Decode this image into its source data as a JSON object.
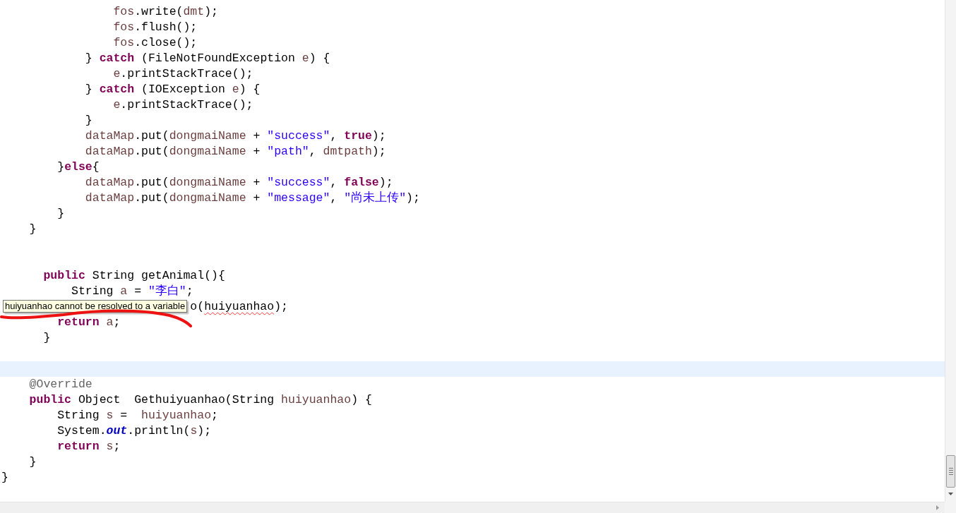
{
  "editor": {
    "lines": [
      {
        "current": false,
        "tokens": [
          {
            "text": "                fos",
            "kind": "local"
          },
          {
            "text": ".write(",
            "kind": "plain"
          },
          {
            "text": "dmt",
            "kind": "local"
          },
          {
            "text": ");",
            "kind": "plain"
          }
        ]
      },
      {
        "current": false,
        "tokens": [
          {
            "text": "                fos",
            "kind": "local"
          },
          {
            "text": ".flush();",
            "kind": "plain"
          }
        ]
      },
      {
        "current": false,
        "tokens": [
          {
            "text": "                fos",
            "kind": "local"
          },
          {
            "text": ".close();",
            "kind": "plain"
          }
        ]
      },
      {
        "current": false,
        "tokens": [
          {
            "text": "            } ",
            "kind": "plain"
          },
          {
            "text": "catch",
            "kind": "keyword"
          },
          {
            "text": " (FileNotFoundException ",
            "kind": "plain"
          },
          {
            "text": "e",
            "kind": "local"
          },
          {
            "text": ") {",
            "kind": "plain"
          }
        ]
      },
      {
        "current": false,
        "tokens": [
          {
            "text": "                e",
            "kind": "local"
          },
          {
            "text": ".printStackTrace();",
            "kind": "plain"
          }
        ]
      },
      {
        "current": false,
        "tokens": [
          {
            "text": "            } ",
            "kind": "plain"
          },
          {
            "text": "catch",
            "kind": "keyword"
          },
          {
            "text": " (IOException ",
            "kind": "plain"
          },
          {
            "text": "e",
            "kind": "local"
          },
          {
            "text": ") {",
            "kind": "plain"
          }
        ]
      },
      {
        "current": false,
        "tokens": [
          {
            "text": "                e",
            "kind": "local"
          },
          {
            "text": ".printStackTrace();",
            "kind": "plain"
          }
        ]
      },
      {
        "current": false,
        "tokens": [
          {
            "text": "            }",
            "kind": "plain"
          }
        ]
      },
      {
        "current": false,
        "tokens": [
          {
            "text": "            dataMap",
            "kind": "local"
          },
          {
            "text": ".put(",
            "kind": "plain"
          },
          {
            "text": "dongmaiName",
            "kind": "local"
          },
          {
            "text": " + ",
            "kind": "plain"
          },
          {
            "text": "\"success\"",
            "kind": "string"
          },
          {
            "text": ", ",
            "kind": "plain"
          },
          {
            "text": "true",
            "kind": "keyword"
          },
          {
            "text": ");",
            "kind": "plain"
          }
        ]
      },
      {
        "current": false,
        "tokens": [
          {
            "text": "            dataMap",
            "kind": "local"
          },
          {
            "text": ".put(",
            "kind": "plain"
          },
          {
            "text": "dongmaiName",
            "kind": "local"
          },
          {
            "text": " + ",
            "kind": "plain"
          },
          {
            "text": "\"path\"",
            "kind": "string"
          },
          {
            "text": ", ",
            "kind": "plain"
          },
          {
            "text": "dmtpath",
            "kind": "local"
          },
          {
            "text": ");",
            "kind": "plain"
          }
        ]
      },
      {
        "current": false,
        "tokens": [
          {
            "text": "        }",
            "kind": "plain"
          },
          {
            "text": "else",
            "kind": "keyword"
          },
          {
            "text": "{",
            "kind": "plain"
          }
        ]
      },
      {
        "current": false,
        "tokens": [
          {
            "text": "            dataMap",
            "kind": "local"
          },
          {
            "text": ".put(",
            "kind": "plain"
          },
          {
            "text": "dongmaiName",
            "kind": "local"
          },
          {
            "text": " + ",
            "kind": "plain"
          },
          {
            "text": "\"success\"",
            "kind": "string"
          },
          {
            "text": ", ",
            "kind": "plain"
          },
          {
            "text": "false",
            "kind": "keyword"
          },
          {
            "text": ");",
            "kind": "plain"
          }
        ]
      },
      {
        "current": false,
        "tokens": [
          {
            "text": "            dataMap",
            "kind": "local"
          },
          {
            "text": ".put(",
            "kind": "plain"
          },
          {
            "text": "dongmaiName",
            "kind": "local"
          },
          {
            "text": " + ",
            "kind": "plain"
          },
          {
            "text": "\"message\"",
            "kind": "string"
          },
          {
            "text": ", ",
            "kind": "plain"
          },
          {
            "text": "\"尚未上传\"",
            "kind": "string"
          },
          {
            "text": ");",
            "kind": "plain"
          }
        ]
      },
      {
        "current": false,
        "tokens": [
          {
            "text": "        }",
            "kind": "plain"
          }
        ]
      },
      {
        "current": false,
        "tokens": [
          {
            "text": "    }",
            "kind": "plain"
          }
        ]
      },
      {
        "current": false
      },
      {
        "current": false
      },
      {
        "current": false,
        "tokens": [
          {
            "text": "      public",
            "kind": "keyword"
          },
          {
            "text": " String getAnimal(){",
            "kind": "plain"
          }
        ]
      },
      {
        "current": false,
        "tokens": [
          {
            "text": "          String ",
            "kind": "plain"
          },
          {
            "text": "a",
            "kind": "local"
          },
          {
            "text": " = ",
            "kind": "plain"
          },
          {
            "text": "\"李白\"",
            "kind": "string"
          },
          {
            "text": ";",
            "kind": "plain"
          }
        ]
      },
      {
        "current": false,
        "tokens": [
          {
            "text": "                           o(",
            "kind": "plain"
          },
          {
            "text": "huiyuanhao",
            "kind": "error"
          },
          {
            "text": ");",
            "kind": "plain"
          }
        ]
      },
      {
        "current": false,
        "tokens": [
          {
            "text": "        return ",
            "kind": "keyword"
          },
          {
            "text": "a",
            "kind": "local"
          },
          {
            "text": ";",
            "kind": "plain"
          }
        ]
      },
      {
        "current": false,
        "tokens": [
          {
            "text": "      }",
            "kind": "plain"
          }
        ]
      },
      {
        "current": false
      },
      {
        "current": true
      },
      {
        "current": false,
        "tokens": [
          {
            "text": "    @Override",
            "kind": "annotation"
          }
        ]
      },
      {
        "current": false,
        "tokens": [
          {
            "text": "    public",
            "kind": "keyword"
          },
          {
            "text": " Object  Gethuiyuanhao(String ",
            "kind": "plain"
          },
          {
            "text": "huiyuanhao",
            "kind": "local"
          },
          {
            "text": ") {",
            "kind": "plain"
          }
        ]
      },
      {
        "current": false,
        "tokens": [
          {
            "text": "        String ",
            "kind": "plain"
          },
          {
            "text": "s",
            "kind": "local"
          },
          {
            "text": " =  ",
            "kind": "plain"
          },
          {
            "text": "huiyuanhao",
            "kind": "local"
          },
          {
            "text": ";",
            "kind": "plain"
          }
        ]
      },
      {
        "current": false,
        "tokens": [
          {
            "text": "        System.",
            "kind": "plain"
          },
          {
            "text": "out",
            "kind": "field"
          },
          {
            "text": ".println(",
            "kind": "plain"
          },
          {
            "text": "s",
            "kind": "local"
          },
          {
            "text": ");",
            "kind": "plain"
          }
        ]
      },
      {
        "current": false,
        "tokens": [
          {
            "text": "        return ",
            "kind": "keyword"
          },
          {
            "text": "s",
            "kind": "local"
          },
          {
            "text": ";",
            "kind": "plain"
          }
        ]
      },
      {
        "current": false,
        "tokens": [
          {
            "text": "    }",
            "kind": "plain"
          }
        ]
      },
      {
        "current": false,
        "tokens": [
          {
            "text": "}",
            "kind": "plain"
          }
        ]
      }
    ]
  },
  "tooltip": {
    "text": "huiyuanhao cannot be resolved to a variable"
  }
}
